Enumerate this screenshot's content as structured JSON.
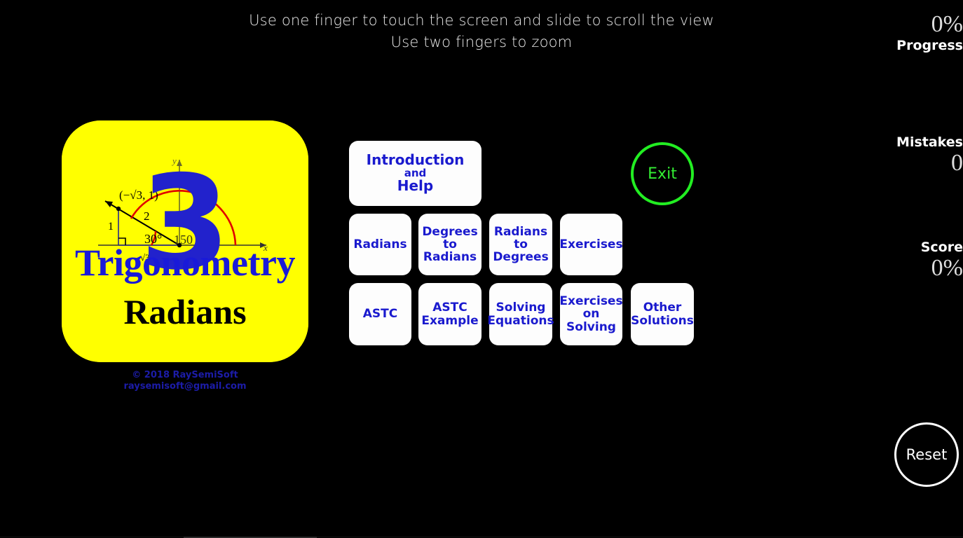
{
  "instructions": {
    "line1": "Use one finger to touch the screen and slide to scroll the view",
    "line2": "Use two fingers to zoom"
  },
  "status": {
    "progress": {
      "label": "Progress",
      "value": "0%"
    },
    "mistakes": {
      "label": "Mistakes",
      "value": "0"
    },
    "score": {
      "label": "Score",
      "value": "0%"
    }
  },
  "buttons": {
    "exit": "Exit",
    "reset": "Reset",
    "intro": {
      "line1": "Introduction",
      "line2": "and",
      "line3": "Help"
    },
    "radians": {
      "line1": "Radians"
    },
    "degrees_to_radians": {
      "line1": "Degrees",
      "line2": "to",
      "line3": "Radians"
    },
    "radians_to_degrees": {
      "line1": "Radians",
      "line2": "to",
      "line3": "Degrees"
    },
    "exercises": {
      "line1": "Exercises"
    },
    "astc": {
      "line1": "ASTC"
    },
    "astc_example": {
      "line1": "ASTC",
      "line2": "Example"
    },
    "solving_equations": {
      "line1": "Solving",
      "line2": "Equations"
    },
    "exercises_on_solving": {
      "line1": "Exercises",
      "line2": "on",
      "line3": "Solving"
    },
    "other_solutions": {
      "line1": "Other",
      "line2": "Solutions"
    }
  },
  "logo": {
    "numeral": "3",
    "title": "Trigonometry",
    "subtitle": "Radians",
    "diagram": {
      "point_label": "(−√3, 1)",
      "side_vertical": "1",
      "side_hypotenuse": "2",
      "side_horizontal": "√3",
      "angle_small": "30°",
      "angle_large": "150",
      "axis_x": "x",
      "axis_y": "y"
    }
  },
  "copyright": {
    "line1": "© 2018 RaySemiSoft",
    "line2": "raysemisoft@gmail.com"
  },
  "colors": {
    "background": "#000000",
    "card": "#ffff00",
    "button_text": "#1a1ace",
    "exit": "#22ee22",
    "reset": "#ffffff",
    "accent_red": "#e00000"
  }
}
